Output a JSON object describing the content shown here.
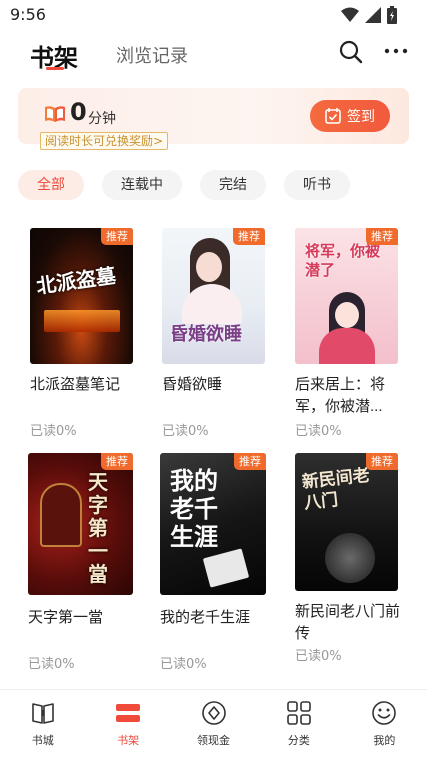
{
  "status_bar": {
    "time": "9:56"
  },
  "header": {
    "active_tab": "书架",
    "inactive_tab": "浏览记录"
  },
  "banner": {
    "minutes_value": "0",
    "minutes_unit": "分钟",
    "reward_tip": "阅读时长可兑换奖励>",
    "checkin_label": "签到"
  },
  "filters": [
    {
      "label": "全部",
      "selected": true
    },
    {
      "label": "连载中",
      "selected": false
    },
    {
      "label": "完结",
      "selected": false
    },
    {
      "label": "听书",
      "selected": false
    }
  ],
  "books": [
    {
      "title": "北派盗墓笔记",
      "progress": "已读0%",
      "badge": "推荐",
      "cover_text": "北派盗墓"
    },
    {
      "title": "昏婚欲睡",
      "progress": "已读0%",
      "badge": "推荐",
      "cover_text": "昏婚欲睡"
    },
    {
      "title": "后来居上：将军，你被潜...",
      "progress": "已读0%",
      "badge": "推荐",
      "cover_text": "将军，你被潜了"
    },
    {
      "title": "天字第一當",
      "progress": "已读0%",
      "badge": "推荐",
      "cover_text": "天字第一當"
    },
    {
      "title": "我的老千生涯",
      "progress": "已读0%",
      "badge": "推荐",
      "cover_text": "我的老千生涯"
    },
    {
      "title": "新民间老八门前传",
      "progress": "已读0%",
      "badge": "推荐",
      "cover_text": "新民间老八门"
    }
  ],
  "bottom_nav": [
    {
      "label": "书城",
      "icon": "book-open-icon",
      "active": false
    },
    {
      "label": "书架",
      "icon": "bookshelf-icon",
      "active": true
    },
    {
      "label": "领现金",
      "icon": "coin-icon",
      "active": false
    },
    {
      "label": "分类",
      "icon": "grid-icon",
      "active": false
    },
    {
      "label": "我的",
      "icon": "smiley-icon",
      "active": false
    }
  ],
  "colors": {
    "accent": "#ef4a3a",
    "badge": "#f06a2c",
    "reward_text": "#c9912f"
  }
}
